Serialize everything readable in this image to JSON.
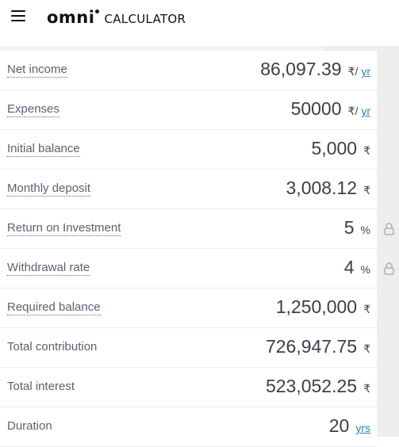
{
  "header": {
    "menu_icon": "hamburger-menu-icon",
    "logo_brand": "omni",
    "logo_product": "CALCULATOR"
  },
  "rows": [
    {
      "label": "Net income",
      "value": "86,097.39",
      "unit_symbol": "₹/",
      "unit_link": "yr",
      "locked": false,
      "dotted": true
    },
    {
      "label": "Expenses",
      "value": "50000",
      "unit_symbol": "₹/",
      "unit_link": "yr",
      "locked": false,
      "dotted": true
    },
    {
      "label": "Initial balance",
      "value": "5,000",
      "unit_symbol": "₹",
      "unit_link": "",
      "locked": false,
      "dotted": true
    },
    {
      "label": "Monthly deposit",
      "value": "3,008.12",
      "unit_symbol": "₹",
      "unit_link": "",
      "locked": false,
      "dotted": true
    },
    {
      "label": "Return on Investment",
      "value": "5",
      "unit_symbol": "%",
      "unit_link": "",
      "locked": true,
      "dotted": true
    },
    {
      "label": "Withdrawal rate",
      "value": "4",
      "unit_symbol": "%",
      "unit_link": "",
      "locked": true,
      "dotted": true
    },
    {
      "label": "Required balance",
      "value": "1,250,000",
      "unit_symbol": "₹",
      "unit_link": "",
      "locked": false,
      "dotted": true
    },
    {
      "label": "Total contribution",
      "value": "726,947.75",
      "unit_symbol": "₹",
      "unit_link": "",
      "locked": false,
      "dotted": false
    },
    {
      "label": "Total interest",
      "value": "523,052.25",
      "unit_symbol": "₹",
      "unit_link": "",
      "locked": false,
      "dotted": false
    },
    {
      "label": "Duration",
      "value": "20",
      "unit_symbol": "",
      "unit_link": "yrs",
      "locked": false,
      "dotted": false
    }
  ],
  "colors": {
    "link": "#2a84c4",
    "label": "#5a6170",
    "value": "#3a3e48",
    "gutter": "#eeeeee"
  }
}
